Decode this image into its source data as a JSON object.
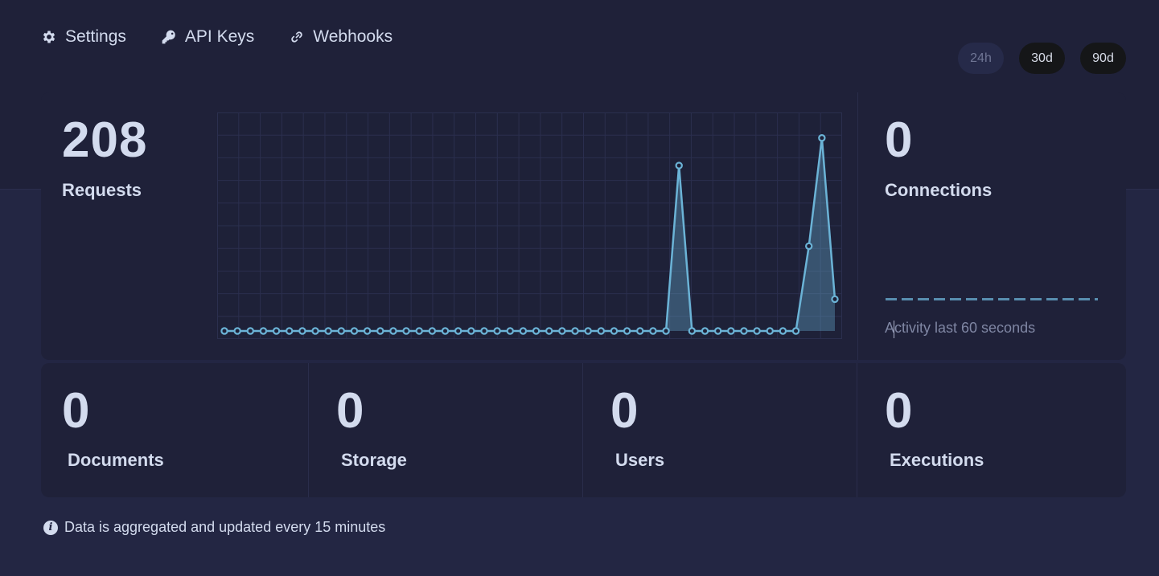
{
  "nav": [
    {
      "label": "Settings",
      "icon": "gear-icon"
    },
    {
      "label": "API Keys",
      "icon": "key-icon"
    },
    {
      "label": "Webhooks",
      "icon": "link-icon"
    }
  ],
  "periods": [
    {
      "label": "24h",
      "state": "inactive"
    },
    {
      "label": "30d",
      "state": "active"
    },
    {
      "label": "90d",
      "state": "active"
    }
  ],
  "requests": {
    "value": "208",
    "label": "Requests"
  },
  "connections": {
    "value": "0",
    "label": "Connections",
    "activity_label": "Activity last 60 seconds"
  },
  "stats": [
    {
      "value": "0",
      "label": "Documents"
    },
    {
      "value": "0",
      "label": "Storage"
    },
    {
      "value": "0",
      "label": "Users"
    },
    {
      "value": "0",
      "label": "Executions"
    }
  ],
  "footer": {
    "text": "Data is aggregated and updated every 15 minutes"
  },
  "colors": {
    "line": "#6bb3d6",
    "background": "#232643",
    "card": "#1f2139"
  },
  "chart_data": {
    "type": "area",
    "title": "",
    "xlabel": "",
    "ylabel": "",
    "grid": true,
    "series": [
      {
        "values": [
          0,
          0,
          0,
          0,
          0,
          0,
          0,
          0,
          0,
          0,
          0,
          0,
          0,
          0,
          0,
          0,
          0,
          0,
          0,
          0,
          0,
          0,
          0,
          0,
          0,
          0,
          0,
          0,
          0,
          0,
          0,
          0,
          0,
          0,
          0,
          78,
          0,
          0,
          0,
          0,
          0,
          0,
          0,
          0,
          0,
          40,
          91,
          15
        ]
      }
    ],
    "ylim": [
      0,
      100
    ]
  }
}
